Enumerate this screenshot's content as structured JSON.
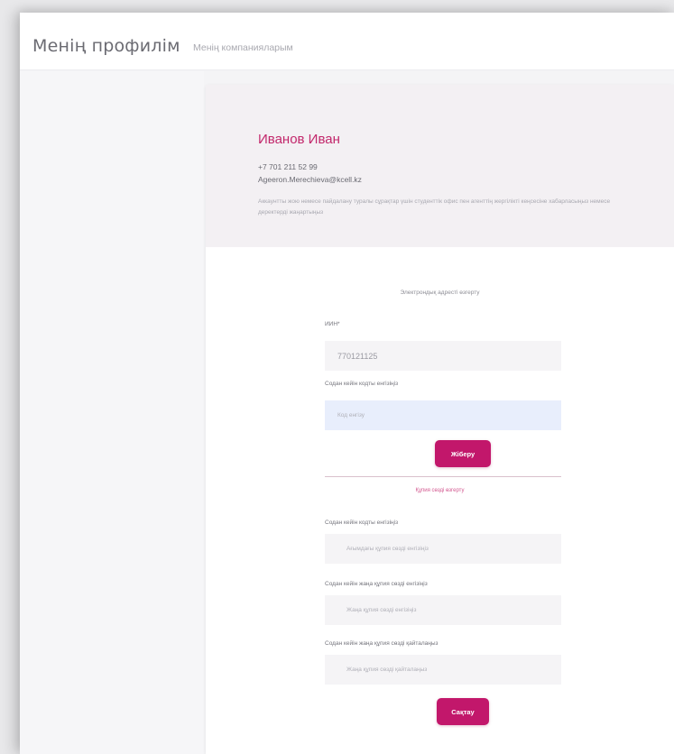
{
  "header": {
    "title": "Менің профилім",
    "tab_companies": "Менің компанияларым"
  },
  "profile": {
    "name": "Иванов Иван",
    "phone": "+7 701 211 52 99",
    "email": "Ageeron.Merechieva@kcell.kz",
    "note": "Аккаунтты жою немесе пайдалану туралы сұрақтар үшін студенттік офис пен агенттің жергілікті кеңсесіне хабарласыңыз немесе деректерді жаңартыңыз"
  },
  "iin_section": {
    "title": "Электрондық адресті өзгерту",
    "iin_label": "ИИН*",
    "iin_value": "770121125",
    "code_label": "Содан кейін кодты енгізіңіз",
    "code_placeholder": "Код енгізу",
    "confirm_button": "Жіберу"
  },
  "password_section": {
    "link_text": "Құпия сөзді өзгерту",
    "current_label": "Содан кейін кодты енгізіңіз",
    "current_placeholder": "Ағымдағы құпия сөзді енгізіңіз",
    "new_label": "Содан кейін жаңа құпия сөзді енгізіңіз",
    "new_placeholder": "Жаңа құпия сөзді енгізіңіз",
    "repeat_label": "Содан кейін жаңа құпия сөзді қайталаңыз",
    "repeat_placeholder": "Жаңа құпия сөзді қайталаңыз",
    "save_button": "Сақтау"
  },
  "colors": {
    "accent": "#c2176b",
    "name": "#c2276b",
    "profile_bg": "#f3f0f3",
    "active_field": "#e8eefc"
  }
}
